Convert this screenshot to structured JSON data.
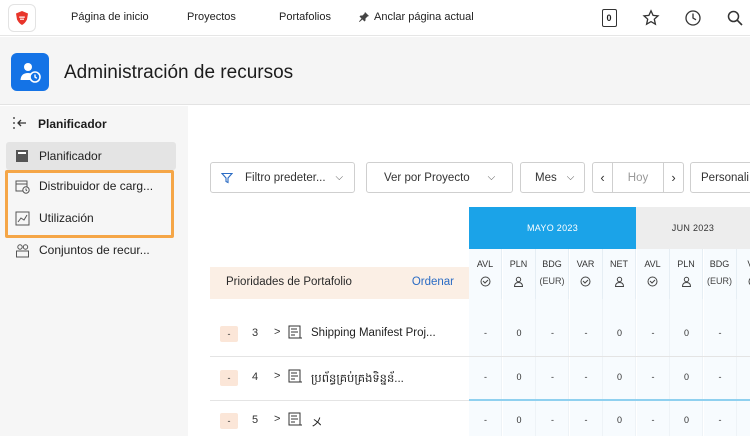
{
  "topnav": {
    "links": [
      "Página de inicio",
      "Proyectos",
      "Portafolios"
    ],
    "pin_label": "Anclar página actual",
    "badge": "0"
  },
  "header": {
    "title": "Administración de recursos",
    "icon_color": "#1473e6"
  },
  "sidebar": {
    "title": "Planificador",
    "items": [
      {
        "label": "Planificador",
        "icon": "planner-icon",
        "active": true
      },
      {
        "label": "Distribuidor de carg...",
        "icon": "calendar-clock-icon",
        "active": false
      },
      {
        "label": "Utilización",
        "icon": "line-chart-icon",
        "active": false
      },
      {
        "label": "Conjuntos de recur...",
        "icon": "resource-pools-icon",
        "active": false
      }
    ],
    "highlight_color": "#f5a647"
  },
  "toolbar": {
    "filter_label": "Filtro predeter...",
    "view_label": "Ver por Proyecto",
    "period_label": "Mes",
    "today_label": "Hoy",
    "customize_label": "Personali"
  },
  "timeline": {
    "months": [
      "MAYO 2023",
      "JUN 2023"
    ],
    "active_color": "#1ba3e8"
  },
  "priorities": {
    "title": "Prioridades de Portafolio",
    "sort_label": "Ordenar"
  },
  "columns": [
    {
      "label": "AVL",
      "sub": "clock"
    },
    {
      "label": "PLN",
      "sub": "person"
    },
    {
      "label": "BDG",
      "sub": "(EUR)"
    },
    {
      "label": "VAR",
      "sub": "clock"
    },
    {
      "label": "NET",
      "sub": "person"
    },
    {
      "label": "AVL",
      "sub": "clock"
    },
    {
      "label": "PLN",
      "sub": "person"
    },
    {
      "label": "BDG",
      "sub": "(EUR)"
    },
    {
      "label": "VA",
      "sub": "clock"
    }
  ],
  "rows": [
    {
      "minus": "-",
      "num": "3",
      "name": "Shipping Manifest Proj...",
      "cells": [
        "-",
        "0",
        "-",
        "-",
        "0",
        "-",
        "0",
        "-",
        "-"
      ]
    },
    {
      "minus": "-",
      "num": "4",
      "name": "ប្រព័ន្ធគ្រប់គ្រងទិន្នន័...",
      "cells": [
        "-",
        "0",
        "-",
        "-",
        "0",
        "-",
        "0",
        "-",
        "-"
      ]
    },
    {
      "minus": "-",
      "num": "5",
      "name": "メ",
      "cells": [
        "-",
        "0",
        "-",
        "-",
        "0",
        "-",
        "0",
        "-",
        "-"
      ]
    }
  ]
}
